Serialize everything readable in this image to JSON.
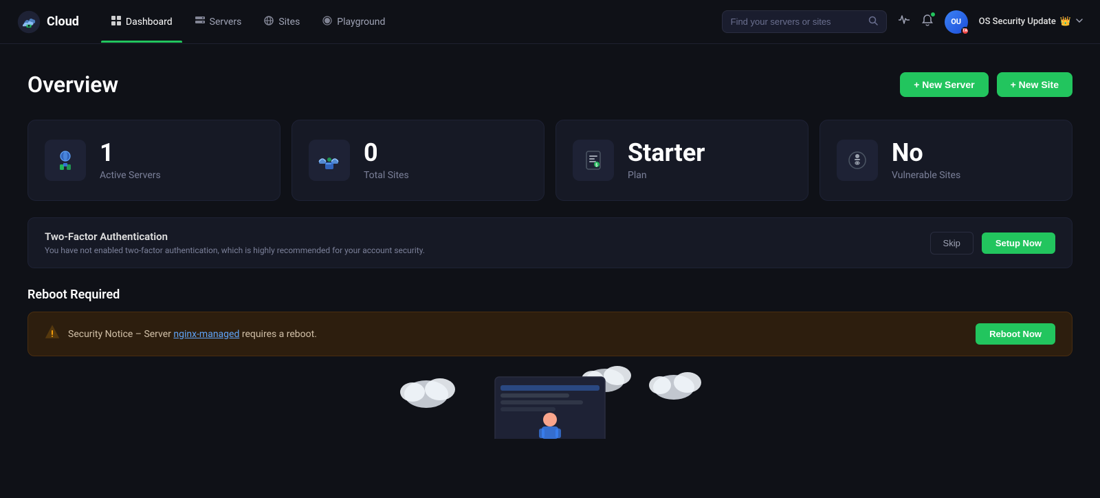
{
  "brand": {
    "name": "Cloud"
  },
  "navbar": {
    "search_placeholder": "Find your servers or sites",
    "user_initials": "OU",
    "user_badge": "TA",
    "user_status_label": "OS Security Update",
    "notification_has_dot": true
  },
  "nav_items": [
    {
      "id": "dashboard",
      "label": "Dashboard",
      "active": true
    },
    {
      "id": "servers",
      "label": "Servers",
      "active": false
    },
    {
      "id": "sites",
      "label": "Sites",
      "active": false
    },
    {
      "id": "playground",
      "label": "Playground",
      "active": false
    }
  ],
  "page": {
    "title": "Overview",
    "new_server_label": "+ New Server",
    "new_site_label": "+ New Site"
  },
  "stat_cards": [
    {
      "id": "active-servers",
      "number": "1",
      "label": "Active Servers",
      "icon": "🌐"
    },
    {
      "id": "total-sites",
      "number": "0",
      "label": "Total Sites",
      "icon": "☁"
    },
    {
      "id": "plan",
      "number": "Starter",
      "label": "Plan",
      "icon": "🧾"
    },
    {
      "id": "vulnerable",
      "number": "No",
      "label": "Vulnerable Sites",
      "icon": "🐛"
    }
  ],
  "two_factor": {
    "title": "Two-Factor Authentication",
    "description": "You have not enabled two-factor authentication, which is highly recommended for your account security.",
    "skip_label": "Skip",
    "setup_label": "Setup Now"
  },
  "reboot": {
    "section_title": "Reboot Required",
    "notice_text_prefix": "Security Notice – Server ",
    "server_name": "nginx-managed",
    "notice_text_suffix": " requires a reboot.",
    "reboot_btn_label": "Reboot Now"
  }
}
